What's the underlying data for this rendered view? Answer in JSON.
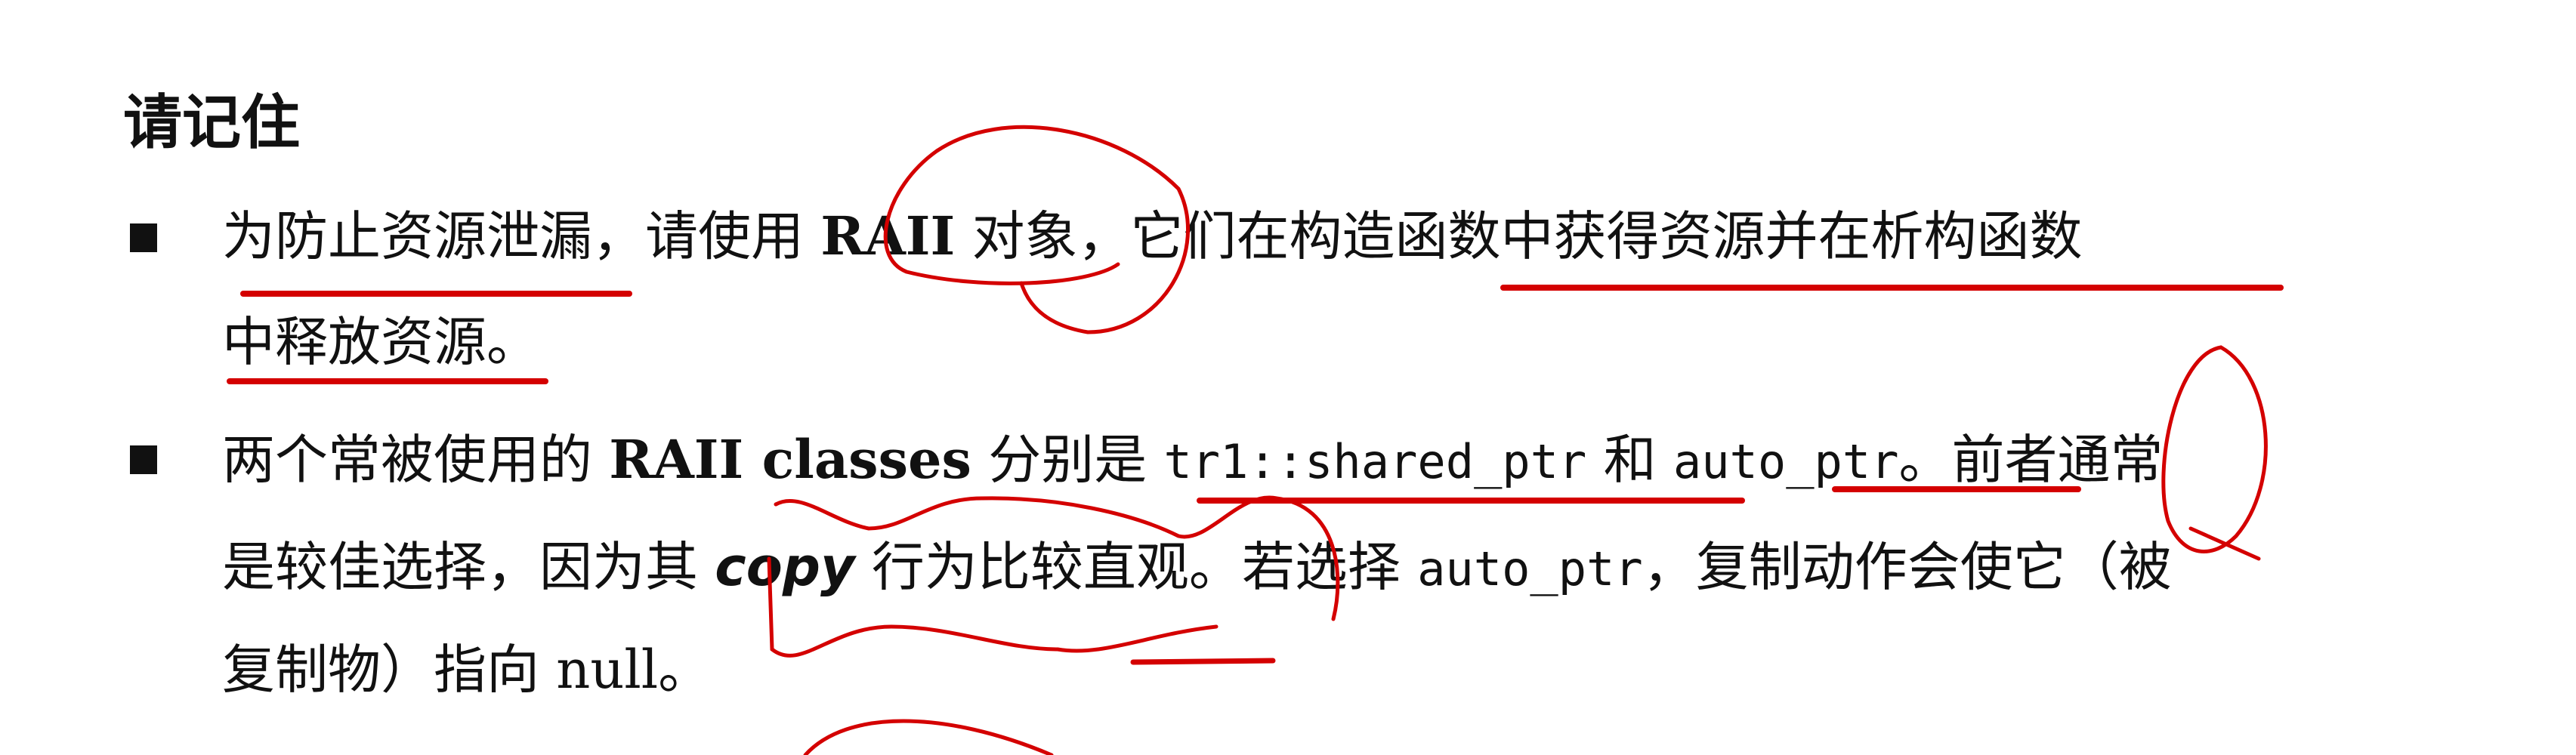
{
  "heading": "请记住",
  "bullets": [
    {
      "line1_a": "为防止资源泄漏，请使用 ",
      "line1_b": "RAII",
      "line1_c": " 对象，它们在构造函数中获得资源并在析构函数",
      "line2": "中释放资源。"
    },
    {
      "line1_a": "两个常被使用的 ",
      "line1_b": "RAII classes",
      "line1_c": " 分别是 ",
      "line1_code1": "tr1::shared_ptr",
      "line1_d": " 和 ",
      "line1_code2": "auto_ptr",
      "line1_e": "。前者通常",
      "line2_a": "是较佳选择，因为其 ",
      "line2_copy": "copy",
      "line2_b": " 行为比较直观。若选择 ",
      "line2_code": "auto_ptr",
      "line2_c": "，复制动作会使它（被",
      "line3": "复制物）指向 null。"
    }
  ],
  "annotation_color": "#d40000"
}
